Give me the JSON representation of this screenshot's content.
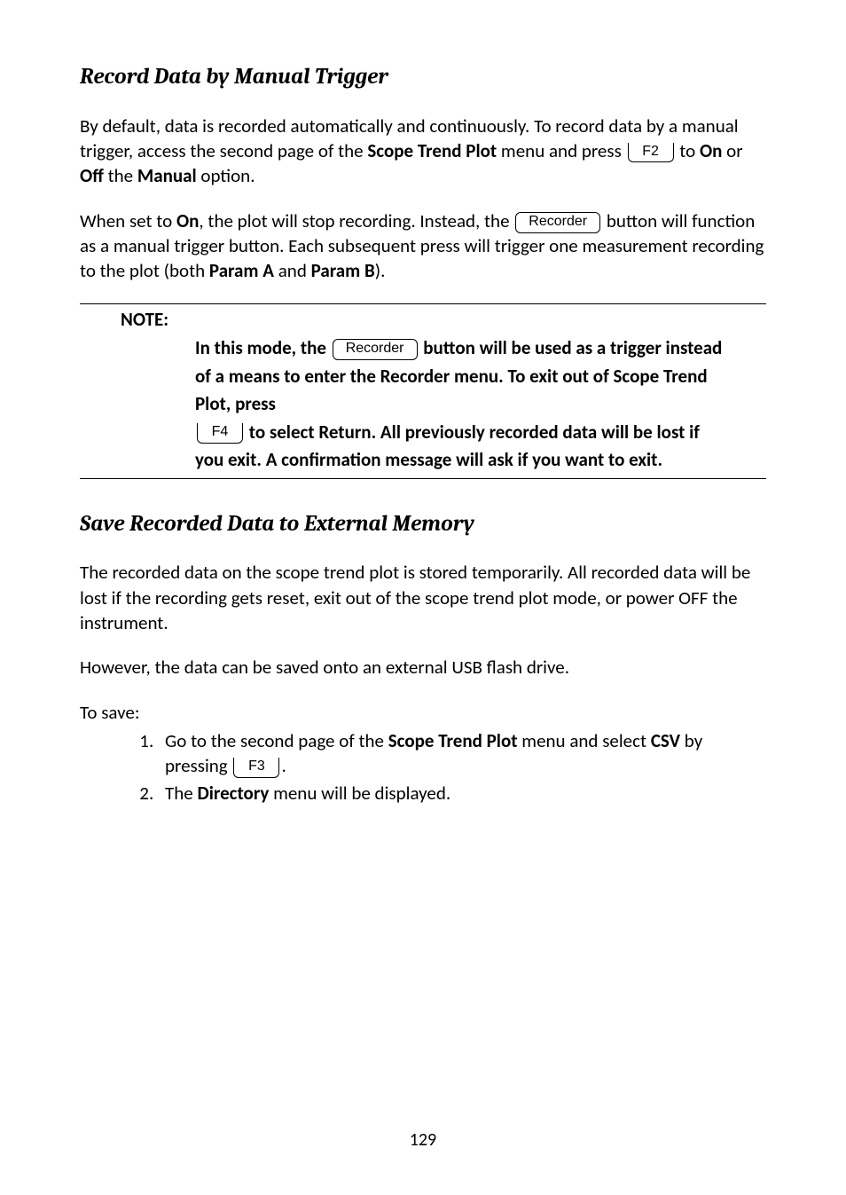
{
  "section1": {
    "title": "Record Data by Manual Trigger",
    "p1_a": "By default, data is recorded automatically and continuously.  To record data by a manual trigger, access the second page of the ",
    "p1_b": "Scope Trend Plot",
    "p1_c": " menu and press ",
    "p1_key": "F2",
    "p1_d": " to ",
    "p1_e": "On",
    "p1_f": " or ",
    "p1_g": "Off",
    "p1_h": " the ",
    "p1_i": "Manual",
    "p1_j": " option.",
    "p2_a": "When set to ",
    "p2_b": "On",
    "p2_c": ", the plot will stop recording.  Instead, the ",
    "p2_key": "Recorder",
    "p2_d": " button will function as a manual trigger button.  Each subsequent press will trigger one measurement recording to the plot (both ",
    "p2_e": "Param A",
    "p2_f": " and ",
    "p2_g": "Param B",
    "p2_h": ")."
  },
  "note": {
    "heading": "NOTE:",
    "a": "In this mode, the ",
    "key1": "Recorder",
    "b": " button will be used as a trigger instead of a means to enter  the Recorder menu.  To exit out of Scope Trend Plot, press ",
    "key2": "F4",
    "c": " to select Return.  All previously recorded data will be lost if you exit.  A confirmation message will ask if you want to exit."
  },
  "section2": {
    "title": "Save Recorded Data to External Memory",
    "p1": "The recorded data on the scope trend plot is stored temporarily.  All recorded data will be lost if the recording gets reset, exit out of the scope trend plot mode, or power OFF the instrument.",
    "p2": "However, the data can be saved onto an external USB flash drive.",
    "p3": "To save:",
    "li1_a": "Go to the second page of the ",
    "li1_b": "Scope Trend Plot",
    "li1_c": " menu and select ",
    "li1_d": "CSV",
    "li1_e": " by pressing ",
    "li1_key": "F3",
    "li1_f": ".",
    "li2_a": "The ",
    "li2_b": "Directory",
    "li2_c": " menu will be displayed."
  },
  "page": "129"
}
